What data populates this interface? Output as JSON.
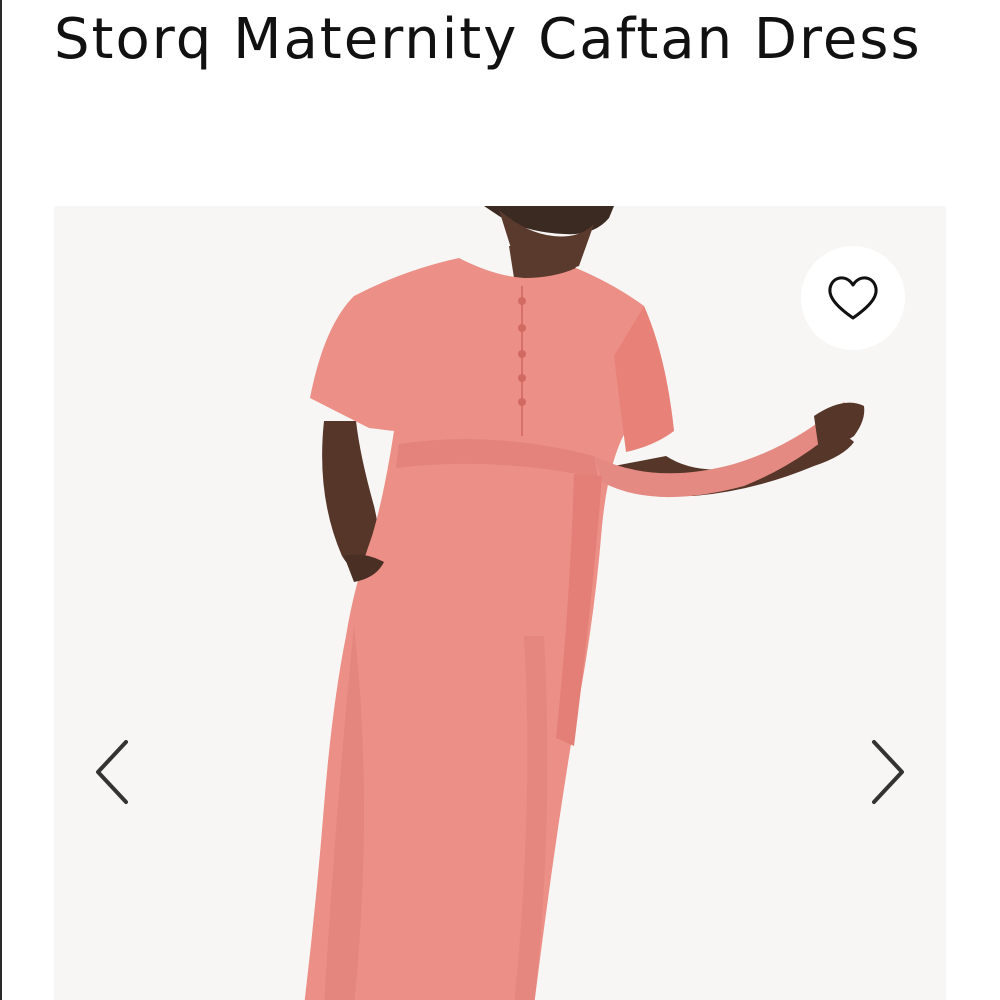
{
  "product": {
    "title": "Storq Maternity Caftan Dress"
  },
  "gallery": {
    "image_alt": "Model wearing pink maternity caftan dress with tie belt",
    "favorite_icon": "heart-outline-icon",
    "prev_icon": "chevron-left-icon",
    "next_icon": "chevron-right-icon"
  },
  "colors": {
    "dress": "#ec8f86",
    "skin": "#5a3a2c",
    "background": "#f7f6f4",
    "text": "#111111"
  }
}
